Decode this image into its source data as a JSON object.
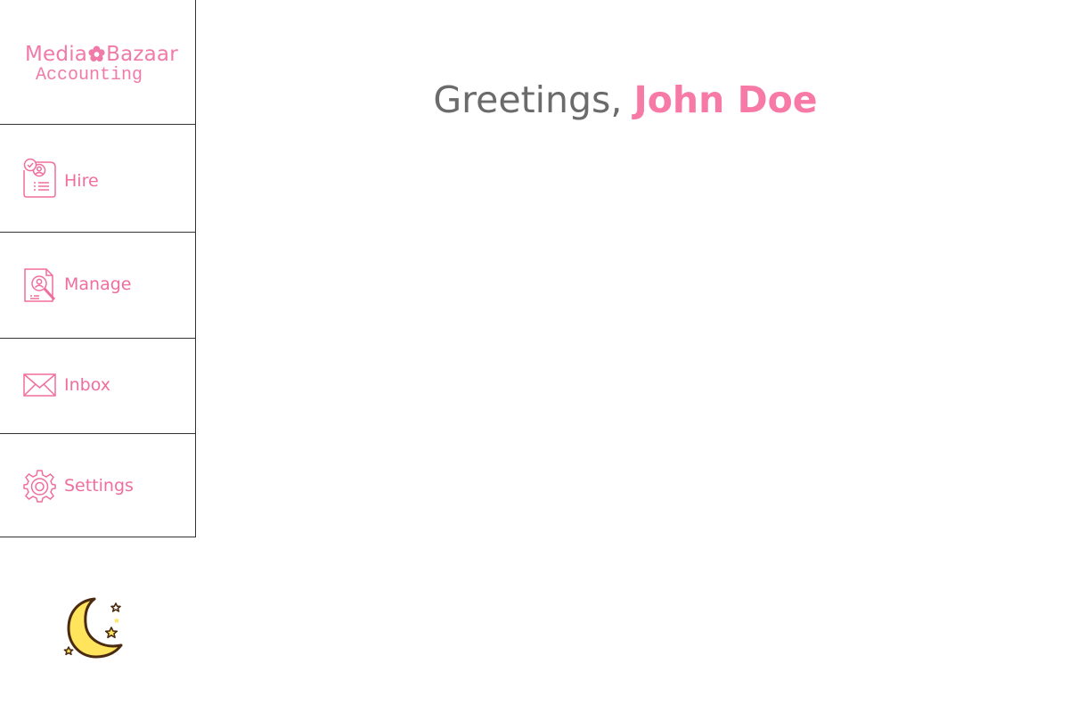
{
  "app": {
    "logo_line1_a": "Media",
    "logo_line1_b": "Bazaar",
    "logo_line2": "Accounting"
  },
  "sidebar": {
    "items": [
      {
        "label": "Hire",
        "icon": "resume-icon"
      },
      {
        "label": "Manage",
        "icon": "employee-search-icon"
      },
      {
        "label": "Inbox",
        "icon": "envelope-icon"
      },
      {
        "label": "Settings",
        "icon": "gear-icon"
      }
    ],
    "theme_toggle_icon": "moon-icon"
  },
  "main": {
    "greeting_prefix": "Greetings, ",
    "user_name": "John Doe"
  },
  "colors": {
    "accent": "#f06e9e",
    "greeting_text": "#6b6b6b",
    "border": "#333333",
    "moon_fill": "#ffe45c",
    "moon_outline": "#4a2a10"
  }
}
